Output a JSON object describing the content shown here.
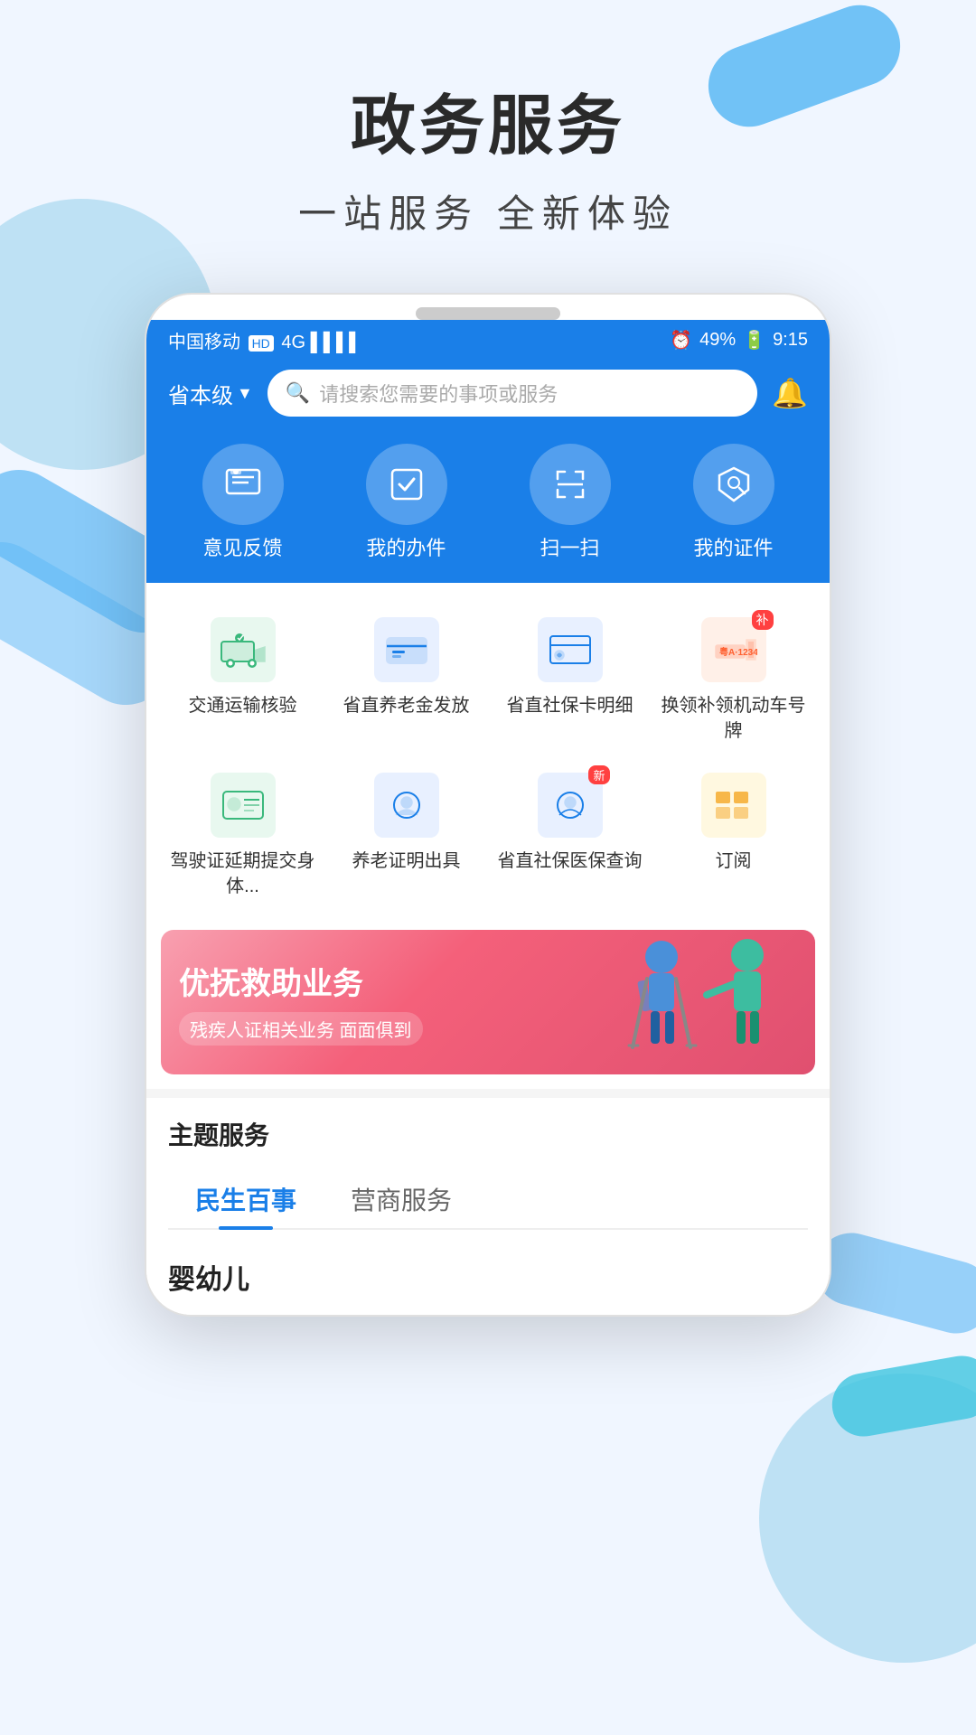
{
  "page": {
    "header_title": "政务服务",
    "header_subtitle": "一站服务   全新体验"
  },
  "status_bar": {
    "carrier": "中国移动",
    "hd_label": "HD",
    "signal": "4G",
    "alarm_icon": "alarm",
    "battery_percent": "49%",
    "time": "9:15"
  },
  "app_header": {
    "location": "省本级",
    "search_placeholder": "请搜索您需要的事项或服务",
    "bell_label": "通知"
  },
  "quick_actions": [
    {
      "id": "feedback",
      "label": "意见反馈",
      "icon": "📋"
    },
    {
      "id": "my-work",
      "label": "我的办件",
      "icon": "☑️"
    },
    {
      "id": "scan",
      "label": "扫一扫",
      "icon": "⊡"
    },
    {
      "id": "my-cert",
      "label": "我的证件",
      "icon": "📦"
    }
  ],
  "services": [
    {
      "id": "transport",
      "label": "交通运输核验",
      "icon": "🚛",
      "color": "#e8f8ef",
      "badge": null
    },
    {
      "id": "pension-pay",
      "label": "省直养老金发放",
      "icon": "💳",
      "color": "#e8f0ff",
      "badge": null
    },
    {
      "id": "social-card",
      "label": "省直社保卡明细",
      "icon": "💰",
      "color": "#e8f0ff",
      "badge": null
    },
    {
      "id": "plate",
      "label": "换领补领机动车号牌",
      "icon": "🚗",
      "color": "#fff0e8",
      "badge": "补"
    },
    {
      "id": "license",
      "label": "驾驶证延期提交身体...",
      "icon": "🪪",
      "color": "#e8f8ef",
      "badge": null
    },
    {
      "id": "pension-cert",
      "label": "养老证明出具",
      "icon": "👁",
      "color": "#e8f0ff",
      "badge": null
    },
    {
      "id": "social-medical",
      "label": "省直社保医保查询",
      "icon": "👁",
      "color": "#e8f0ff",
      "badge": "新"
    },
    {
      "id": "subscribe",
      "label": "订阅",
      "icon": "⊞",
      "color": "#fff8e0",
      "badge": null
    }
  ],
  "banner": {
    "title": "优抚救助业务",
    "subtitle": "残疾人证相关业务  面面俱到"
  },
  "theme_section": {
    "title": "主题服务",
    "tabs": [
      {
        "id": "livelihood",
        "label": "民生百事",
        "active": true
      },
      {
        "id": "business",
        "label": "营商服务",
        "active": false
      }
    ],
    "sub_category": "婴幼儿"
  }
}
